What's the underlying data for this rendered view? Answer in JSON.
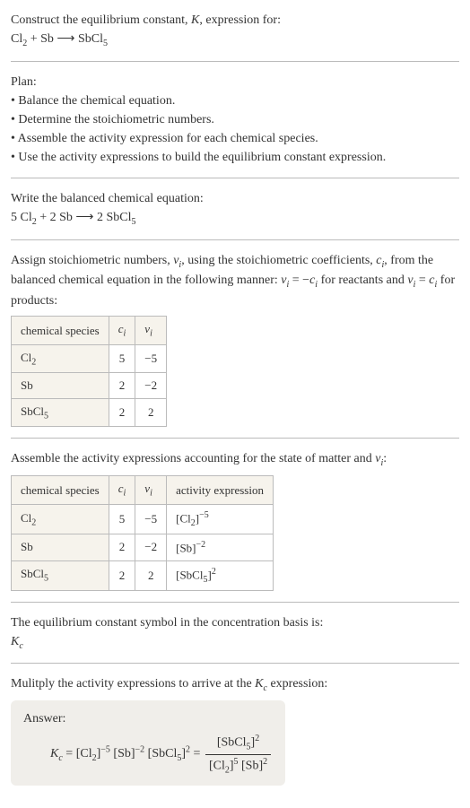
{
  "intro": {
    "line1": "Construct the equilibrium constant, ",
    "k": "K",
    "line2": ", expression for:",
    "eq": "Cl",
    "eq_sub": "2",
    "eq_plus": " + Sb ⟶ SbCl",
    "eq_sub2": "5"
  },
  "plan": {
    "title": "Plan:",
    "b1": "Balance the chemical equation.",
    "b2": "Determine the stoichiometric numbers.",
    "b3": "Assemble the activity expression for each chemical species.",
    "b4": "Use the activity expressions to build the equilibrium constant expression."
  },
  "balance": {
    "title": "Write the balanced chemical equation:",
    "eq_a": "5 Cl",
    "sub1": "2",
    "eq_b": " + 2 Sb ⟶ 2 SbCl",
    "sub2": "5"
  },
  "assign": {
    "text_a": "Assign stoichiometric numbers, ",
    "nu": "ν",
    "i": "i",
    "text_b": ", using the stoichiometric coefficients, ",
    "c": "c",
    "text_c": ", from the balanced chemical equation in the following manner: ",
    "eq1": " = −",
    "text_d": " for reactants and ",
    "eq2": " = ",
    "text_e": " for products:"
  },
  "t1": {
    "h1": "chemical species",
    "h2": "c",
    "h3": "ν",
    "r1": {
      "sp": "Cl",
      "sub": "2",
      "c": "5",
      "v": "−5"
    },
    "r2": {
      "sp": "Sb",
      "sub": "",
      "c": "2",
      "v": "−2"
    },
    "r3": {
      "sp": "SbCl",
      "sub": "5",
      "c": "2",
      "v": "2"
    }
  },
  "assemble": {
    "title_a": "Assemble the activity expressions accounting for the state of matter and ",
    "nu": "ν",
    "i": "i",
    "title_b": ":"
  },
  "t2": {
    "h1": "chemical species",
    "h2": "c",
    "h3": "ν",
    "h4": "activity expression",
    "r1": {
      "sp": "Cl",
      "sub": "2",
      "c": "5",
      "v": "−5",
      "base": "[Cl",
      "bsub": "2",
      "bend": "]",
      "exp": "−5"
    },
    "r2": {
      "sp": "Sb",
      "sub": "",
      "c": "2",
      "v": "−2",
      "base": "[Sb]",
      "bsub": "",
      "bend": "",
      "exp": "−2"
    },
    "r3": {
      "sp": "SbCl",
      "sub": "5",
      "c": "2",
      "v": "2",
      "base": "[SbCl",
      "bsub": "5",
      "bend": "]",
      "exp": "2"
    }
  },
  "symbol": {
    "title": "The equilibrium constant symbol in the concentration basis is:",
    "k": "K",
    "c": "c"
  },
  "multiply": {
    "title": "Mulitply the activity expressions to arrive at the ",
    "k": "K",
    "c": "c",
    "title_b": " expression:"
  },
  "answer": {
    "label": "Answer:",
    "k": "K",
    "c": "c",
    "eq": " = [Cl",
    "s1": "2",
    "e1": "−5",
    "mid1": " [Sb]",
    "e2": "−2",
    "mid2": " [SbCl",
    "s2": "5",
    "e3": "2",
    "eq2": " = ",
    "num_a": "[SbCl",
    "num_s": "5",
    "num_e": "2",
    "den_a": "[Cl",
    "den_s1": "2",
    "den_e1": "5",
    "den_b": " [Sb]",
    "den_e2": "2"
  },
  "chart_data": {
    "type": "table",
    "title": "Stoichiometric and activity tables",
    "tables": [
      {
        "columns": [
          "chemical species",
          "c_i",
          "ν_i"
        ],
        "rows": [
          [
            "Cl2",
            5,
            -5
          ],
          [
            "Sb",
            2,
            -2
          ],
          [
            "SbCl5",
            2,
            2
          ]
        ]
      },
      {
        "columns": [
          "chemical species",
          "c_i",
          "ν_i",
          "activity expression"
        ],
        "rows": [
          [
            "Cl2",
            5,
            -5,
            "[Cl2]^-5"
          ],
          [
            "Sb",
            2,
            -2,
            "[Sb]^-2"
          ],
          [
            "SbCl5",
            2,
            2,
            "[SbCl5]^2"
          ]
        ]
      }
    ]
  }
}
